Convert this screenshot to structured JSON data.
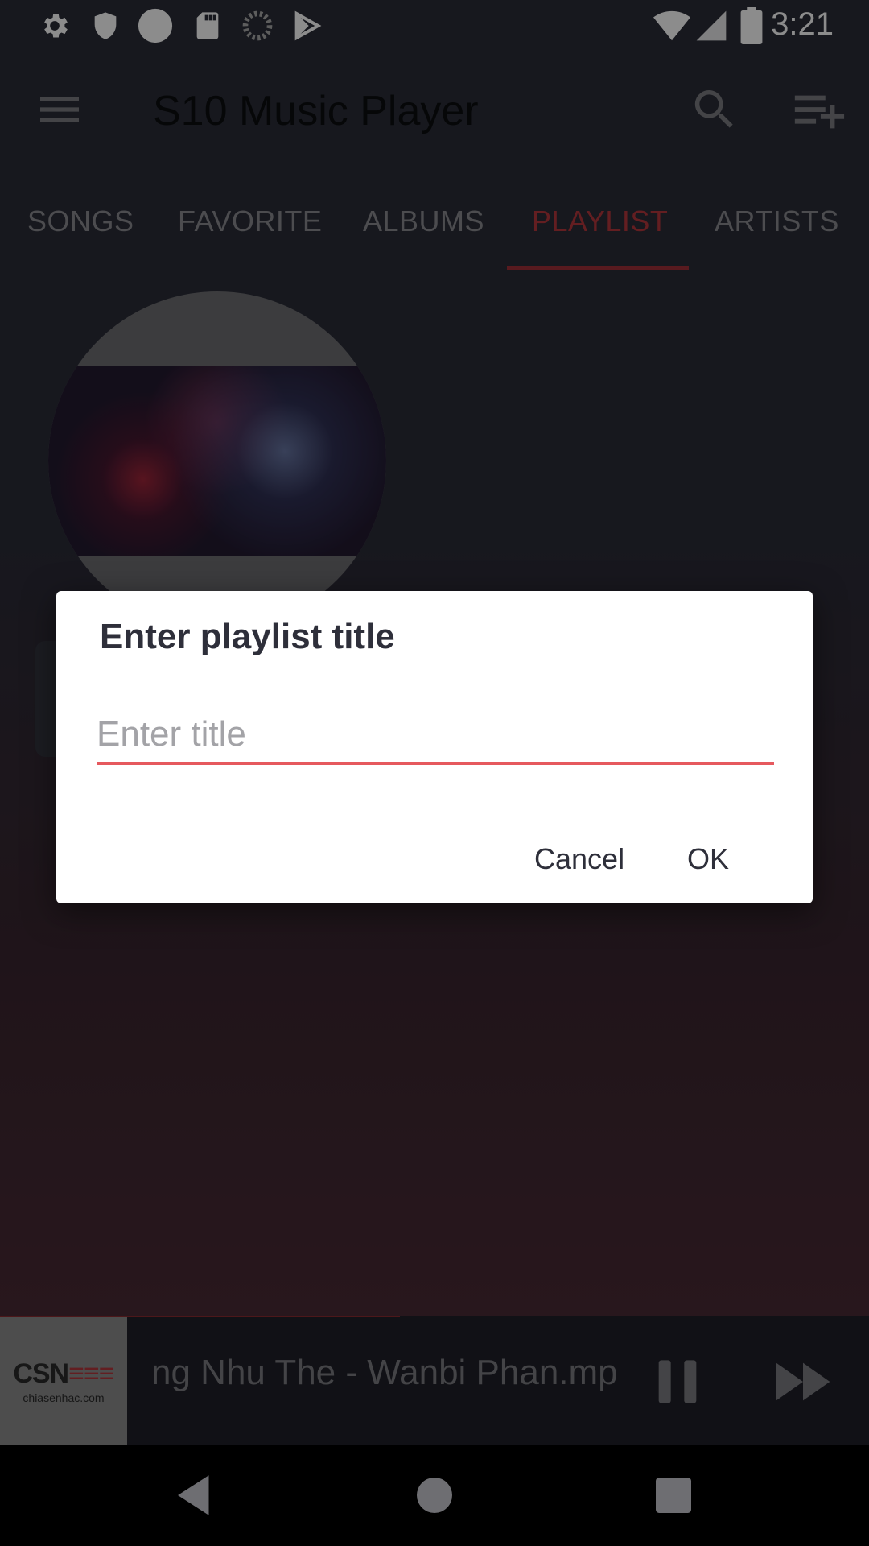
{
  "status_bar": {
    "time": "3:21",
    "left_icons": [
      "gear-icon",
      "shield-icon",
      "circle-icon",
      "sd-card-icon",
      "loading-icon",
      "play-store-icon"
    ],
    "right_icons": [
      "wifi-icon",
      "signal-icon",
      "battery-icon"
    ]
  },
  "toolbar": {
    "title": "S10 Music Player",
    "menu_icon": "hamburger-menu-icon",
    "search_icon": "search-icon",
    "playlist_add_icon": "playlist-add-icon"
  },
  "tabs": [
    {
      "label": "SONGS",
      "active": false
    },
    {
      "label": "FAVORITE",
      "active": false
    },
    {
      "label": "ALBUMS",
      "active": false
    },
    {
      "label": "PLAYLIST",
      "active": true
    },
    {
      "label": "ARTISTS",
      "active": false
    }
  ],
  "dialog": {
    "title": "Enter playlist title",
    "input_value": "",
    "input_placeholder": "Enter title",
    "cancel_label": "Cancel",
    "ok_label": "OK"
  },
  "player": {
    "track_title": "ng Nhu The - Wanbi Phan.mp",
    "thumb_logo_text": "CSN",
    "thumb_logo_sub": "chiasenhac.com",
    "progress": 0.46,
    "pause_icon": "pause-icon",
    "next_icon": "fast-forward-icon"
  },
  "colors": {
    "accent": "#b5373d",
    "input_underline": "#e6595e",
    "background": "#2a2c38"
  },
  "nav_bar": [
    "back-icon",
    "home-icon",
    "recents-icon"
  ]
}
